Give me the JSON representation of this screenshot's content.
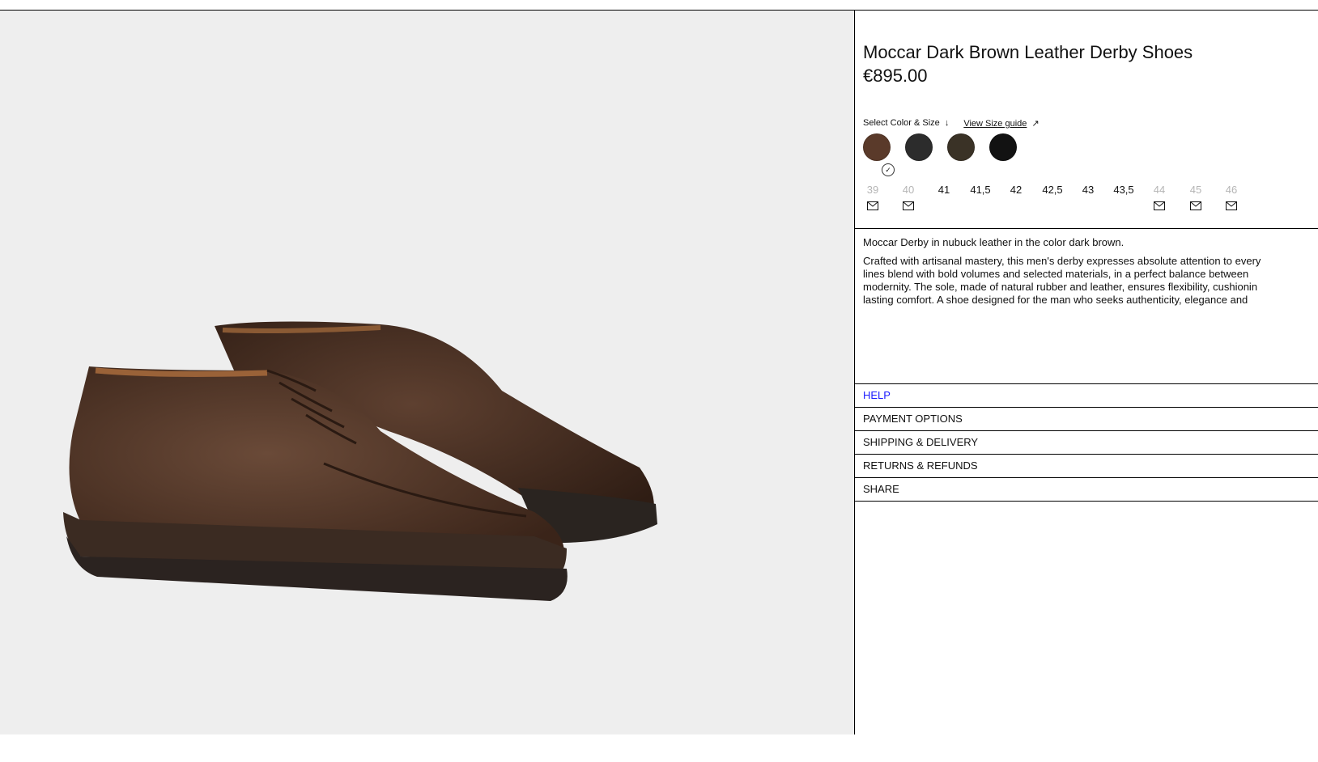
{
  "product": {
    "title": "Moccar Dark Brown Leather Derby Shoes",
    "price": "€895.00"
  },
  "selector": {
    "label": "Select Color & Size",
    "label_arrow": "↓",
    "size_guide": "View Size guide",
    "size_guide_arrow": "↗"
  },
  "colors": [
    {
      "name": "dark brown",
      "hex": "#5a3a2a",
      "selected": true
    },
    {
      "name": "charcoal",
      "hex": "#2c2c2c",
      "selected": false
    },
    {
      "name": "dark olive brown",
      "hex": "#3a3226",
      "selected": false
    },
    {
      "name": "black",
      "hex": "#121212",
      "selected": false
    }
  ],
  "sizes": [
    {
      "label": "39",
      "available": false
    },
    {
      "label": "40",
      "available": false
    },
    {
      "label": "41",
      "available": true
    },
    {
      "label": "41,5",
      "available": true
    },
    {
      "label": "42",
      "available": true
    },
    {
      "label": "42,5",
      "available": true
    },
    {
      "label": "43",
      "available": true
    },
    {
      "label": "43,5",
      "available": true
    },
    {
      "label": "44",
      "available": false
    },
    {
      "label": "45",
      "available": false
    },
    {
      "label": "46",
      "available": false
    }
  ],
  "description": {
    "short": "Moccar Derby in nubuck leather in the color dark brown.",
    "lines": [
      "Crafted with artisanal mastery, this men's derby expresses absolute attention to every",
      "lines blend with bold volumes and selected materials, in a perfect balance between",
      "modernity. The sole, made of natural rubber and leather, ensures flexibility, cushionin",
      "lasting comfort. A shoe designed for the man who seeks authenticity, elegance and"
    ]
  },
  "accordion": {
    "help": "HELP",
    "payment": "PAYMENT OPTIONS",
    "shipping": "SHIPPING & DELIVERY",
    "returns": "RETURNS & REFUNDS",
    "share": "SHARE"
  },
  "colors_theme": {
    "gallery_bg": "#eeeeee",
    "help_link": "#1a1aff",
    "unavailable_size": "#b5b5b5"
  }
}
